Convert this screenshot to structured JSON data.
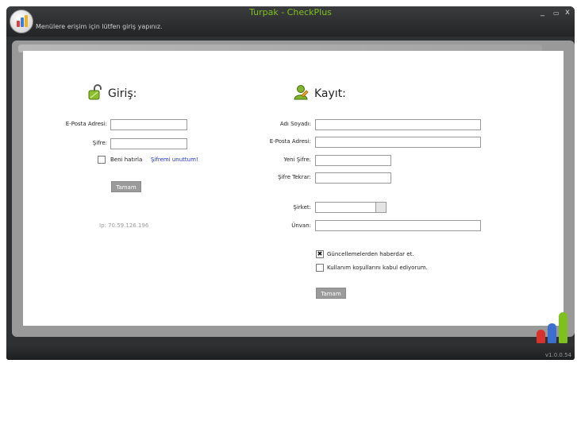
{
  "window": {
    "title": "Turpak - CheckPlus",
    "subtitle": "Menülere erişim için lütfen giriş yapınız.",
    "controls": {
      "minimize": "_",
      "maximize": "▭",
      "close": "x"
    },
    "version": "v1.0.0.54"
  },
  "login": {
    "heading": "Giriş:",
    "email_label": "E-Posta Adresi:",
    "email_value": "",
    "password_label": "Şifre:",
    "password_value": "",
    "remember_label": "Beni hatırla",
    "remember_checked": false,
    "forgot_link": "Şifremi unuttum!",
    "submit_label": "Tamam",
    "ip_text": "Ip: 70.59.126.196"
  },
  "register": {
    "heading": "Kayıt:",
    "fullname_label": "Adı Soyadı:",
    "email_label": "E-Posta Adresi:",
    "new_password_label": "Yeni Şifre:",
    "repeat_password_label": "Şifre Tekrar:",
    "company_label": "Şirket:",
    "company_selected": "",
    "title_label": "Ünvan:",
    "updates_label": "Güncellemelerden haberdar et.",
    "updates_checked": true,
    "terms_label": "Kullanım koşullarını kabul ediyorum.",
    "terms_checked": false,
    "submit_label": "Tamam"
  },
  "colors": {
    "title_green": "#7ec11f",
    "link_blue": "#1a2ed6",
    "button_gray": "#9b9b9b"
  }
}
